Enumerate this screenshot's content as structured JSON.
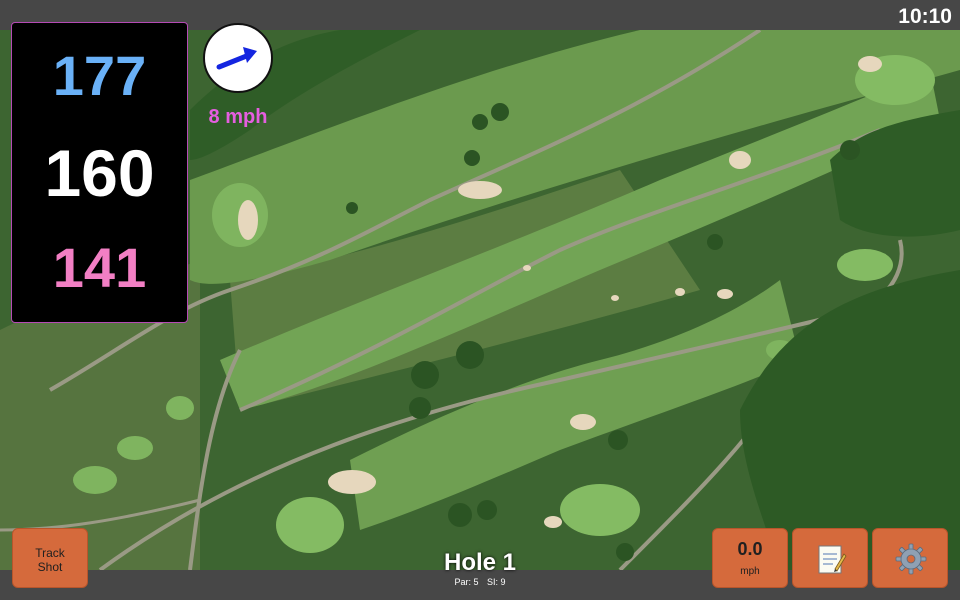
{
  "status_bar": {
    "time": "10:10"
  },
  "distances": {
    "back": "177",
    "middle": "160",
    "front": "141"
  },
  "wind": {
    "speed": "8 mph",
    "icon": "wind-arrow-icon"
  },
  "hole": {
    "title": "Hole 1",
    "par": "Par: 5",
    "si": "SI: 9"
  },
  "buttons": {
    "track_shot_line1": "Track",
    "track_shot_line2": "Shot",
    "speed_value": "0.0",
    "speed_unit": "mph",
    "notes_icon": "notepad-icon",
    "settings_icon": "gear-icon"
  },
  "colors": {
    "distance_back": "#6ab1f7",
    "distance_middle": "#ffffff",
    "distance_front": "#f27fc4",
    "wind_text": "#e55ee0",
    "button": "#d56a3c",
    "bars": "#474747"
  }
}
